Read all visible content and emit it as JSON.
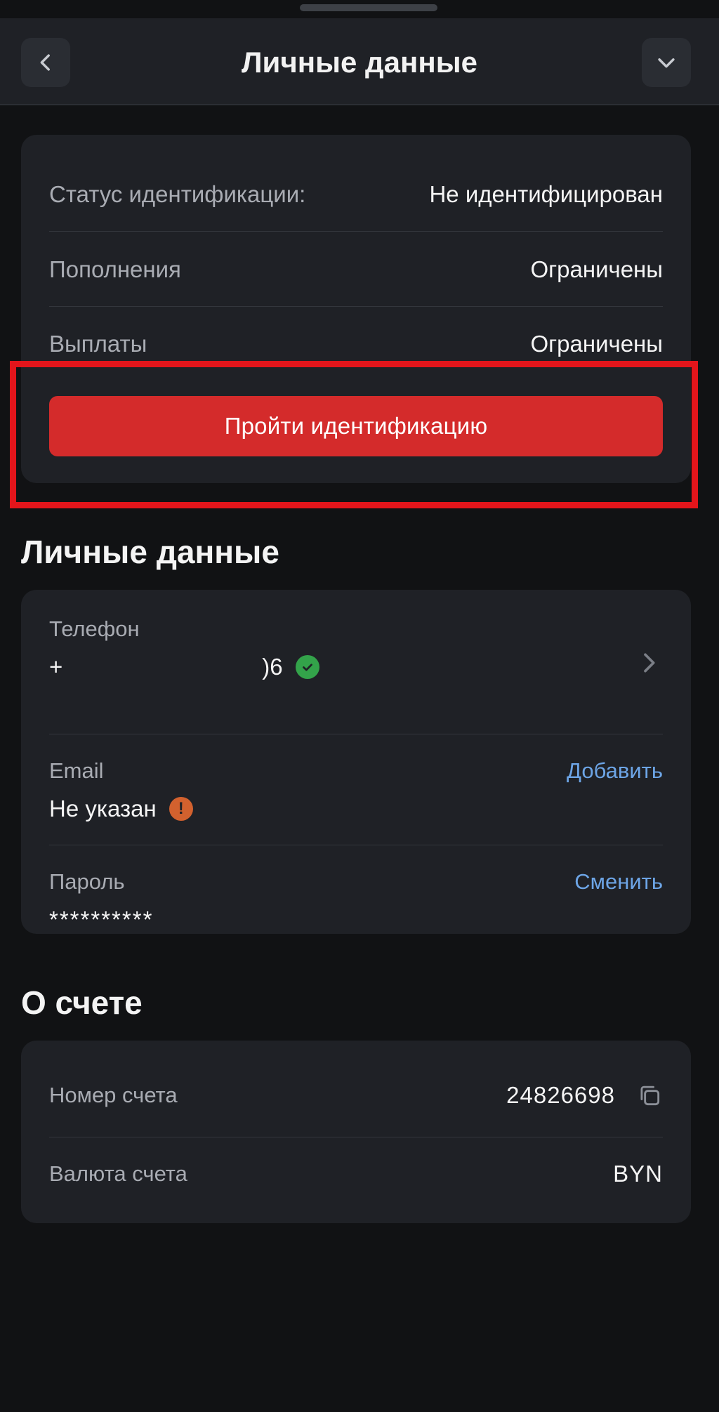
{
  "header": {
    "title": "Личные данные"
  },
  "identification": {
    "rows": [
      {
        "label": "Статус идентификации:",
        "value": "Не идентифицирован"
      },
      {
        "label": "Пополнения",
        "value": "Ограничены"
      },
      {
        "label": "Выплаты",
        "value": "Ограничены"
      }
    ],
    "button_label": "Пройти идентификацию"
  },
  "personal": {
    "section_title": "Личные данные",
    "phone": {
      "label": "Телефон",
      "value_prefix": "+",
      "value_suffix": ")6"
    },
    "email": {
      "label": "Email",
      "value": "Не указан",
      "action": "Добавить"
    },
    "password": {
      "label": "Пароль",
      "value": "**********",
      "action": "Сменить"
    }
  },
  "account": {
    "section_title": "О счете",
    "number": {
      "label": "Номер счета",
      "value": "24826698"
    },
    "currency": {
      "label": "Валюта счета",
      "value": "BYN"
    }
  },
  "colors": {
    "background": "#111214",
    "card": "#1f2126",
    "accent_red": "#d42b2b",
    "highlight_red": "#e3151b",
    "link_blue": "#6da5e6",
    "success_green": "#33a34a",
    "warning_orange": "#d2612e"
  },
  "icons": {
    "back": "chevron-left-icon",
    "collapse": "chevron-down-icon",
    "phone_nav": "chevron-right-icon",
    "verified": "check-circle-icon",
    "warning": "exclamation-circle-icon",
    "copy": "copy-icon"
  }
}
